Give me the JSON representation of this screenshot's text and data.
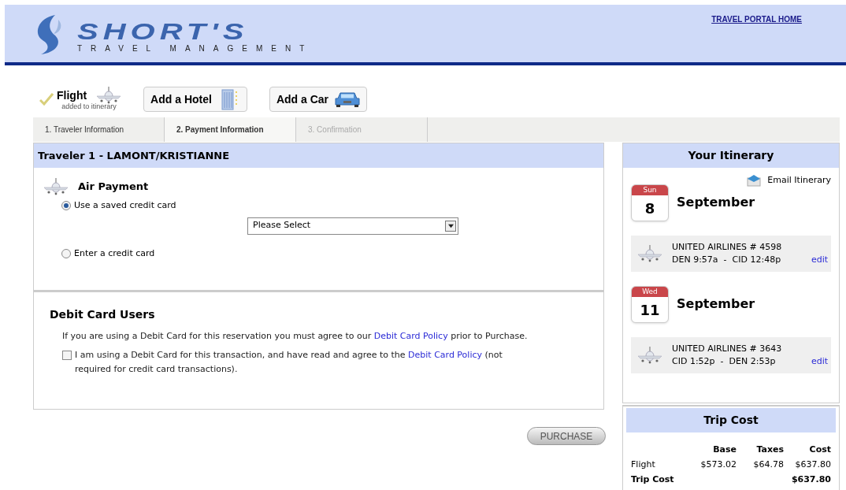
{
  "header": {
    "logo": "SHORT'S",
    "tagline": "TRAVEL MANAGEMENT",
    "home_link": "TRAVEL PORTAL HOME"
  },
  "products": [
    {
      "kind": "flight",
      "label": "Flight",
      "note": "added to itinerary",
      "added": true
    },
    {
      "kind": "hotel",
      "label": "Add a Hotel",
      "added": false
    },
    {
      "kind": "car",
      "label": "Add a Car",
      "added": false
    }
  ],
  "steps": [
    {
      "label": "1. Traveler Information",
      "selected": false,
      "disabled": false
    },
    {
      "label": "2. Payment Information",
      "selected": true,
      "disabled": false
    },
    {
      "label": "3. Confirmation",
      "selected": false,
      "disabled": true
    }
  ],
  "traveler": {
    "title": "Traveler 1 - LAMONT/KRISTIANNE",
    "section": "Air Payment",
    "options": [
      {
        "label": "Use a saved credit card",
        "selected": true
      },
      {
        "label": "Enter a credit card",
        "selected": false
      }
    ],
    "select": {
      "value": "Please Select"
    }
  },
  "debit": {
    "title": "Debit Card Users",
    "notice": {
      "before": "If you are using a Debit Card for this reservation you must agree to our ",
      "link": "Debit Card Policy",
      "after": " prior to Purchase."
    },
    "agree": {
      "checked": false,
      "before": "I am using a Debit Card for this transaction, and have read and agree to the ",
      "link": "Debit Card Policy",
      "after": " (not required for credit card transactions)."
    }
  },
  "purchase": "PURCHASE",
  "itinerary": {
    "title": "Your Itinerary",
    "email": "Email Itinerary",
    "days": [
      {
        "weekday": "Sun",
        "day": "8",
        "month": "September",
        "flight": "UNITED AIRLINES # 4598",
        "route": "DEN 9:57a  -  CID 12:48p",
        "edit": "edit"
      },
      {
        "weekday": "Wed",
        "day": "11",
        "month": "September",
        "flight": "UNITED AIRLINES # 3643",
        "route": "CID 1:52p  -  DEN 2:53p",
        "edit": "edit"
      }
    ]
  },
  "trip_cost": {
    "title": "Trip Cost",
    "columns": [
      "Base",
      "Taxes",
      "Cost"
    ],
    "rows": [
      {
        "label": "Flight",
        "cells": [
          "$573.02",
          "$64.78",
          "$637.80"
        ]
      },
      {
        "label": "Trip Cost",
        "cells": [
          "",
          "",
          "$637.80"
        ]
      }
    ]
  }
}
